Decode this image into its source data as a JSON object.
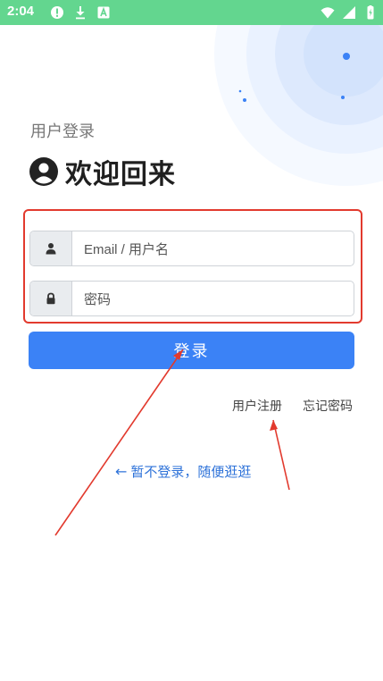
{
  "status_bar": {
    "time": "2:04",
    "icons_left": [
      "alert-icon",
      "download-icon",
      "a-icon"
    ],
    "icons_right": [
      "wifi-icon",
      "signal-icon",
      "battery-icon"
    ]
  },
  "header": {
    "subtitle": "用户登录",
    "title": "欢迎回来"
  },
  "form": {
    "username_placeholder": "Email / 用户名",
    "password_placeholder": "密码"
  },
  "actions": {
    "login_label": "登录",
    "register_label": "用户注册",
    "forgot_label": "忘记密码",
    "guest_label": "暂不登录，随便逛逛"
  },
  "colors": {
    "status_bar": "#63d68f",
    "primary": "#3b82f6",
    "link": "#2f73d9",
    "annotation": "#e23a2e"
  }
}
